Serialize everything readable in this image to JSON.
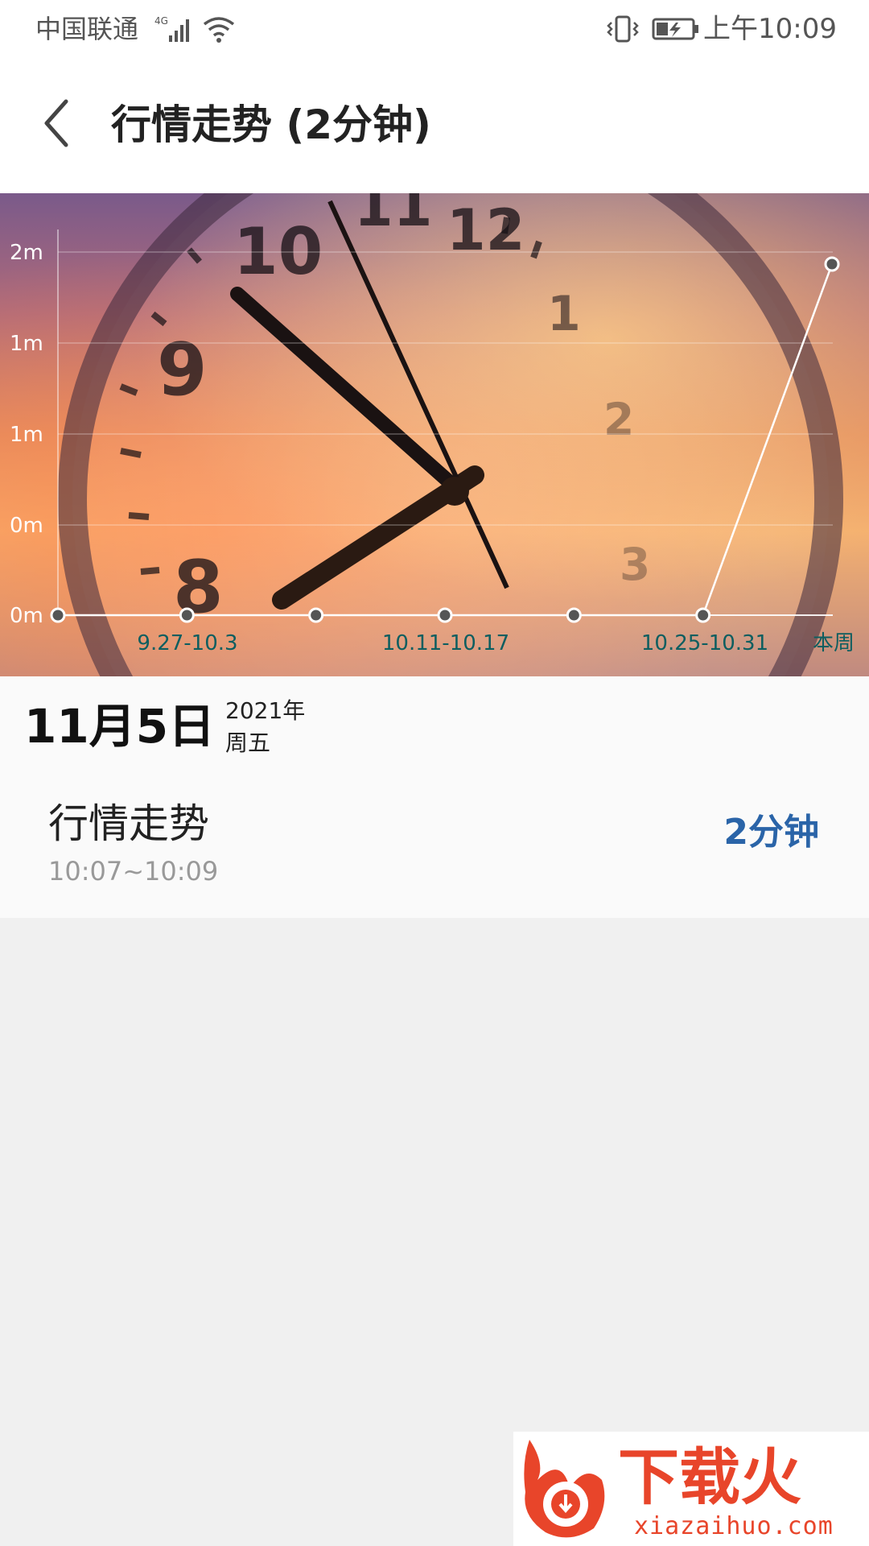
{
  "status_bar": {
    "carrier": "中国联通",
    "network": "4G",
    "time": "上午10:09"
  },
  "header": {
    "title": "行情走势 (2分钟)"
  },
  "chart_data": {
    "type": "line",
    "y_tick_labels": [
      "2m",
      "1m",
      "1m",
      "0m",
      "0m"
    ],
    "x_tick_labels": [
      "9.27-10.3",
      "10.11-10.17",
      "10.25-10.31",
      "本周"
    ],
    "points_minutes": [
      0,
      0,
      0,
      0,
      0,
      0,
      2
    ],
    "ylim": [
      0,
      2.2
    ]
  },
  "date": {
    "day": "11月5日",
    "year": "2021年",
    "weekday": "周五"
  },
  "entry": {
    "name": "行情走势",
    "time_range": "10:07~10:09",
    "duration": "2分钟"
  },
  "watermark": {
    "cn": "下载火",
    "en": "xiazaihuo.com"
  },
  "colors": {
    "accent": "#2a64a8",
    "tick_text": "#0d5e60",
    "watermark": "#e8452a"
  }
}
